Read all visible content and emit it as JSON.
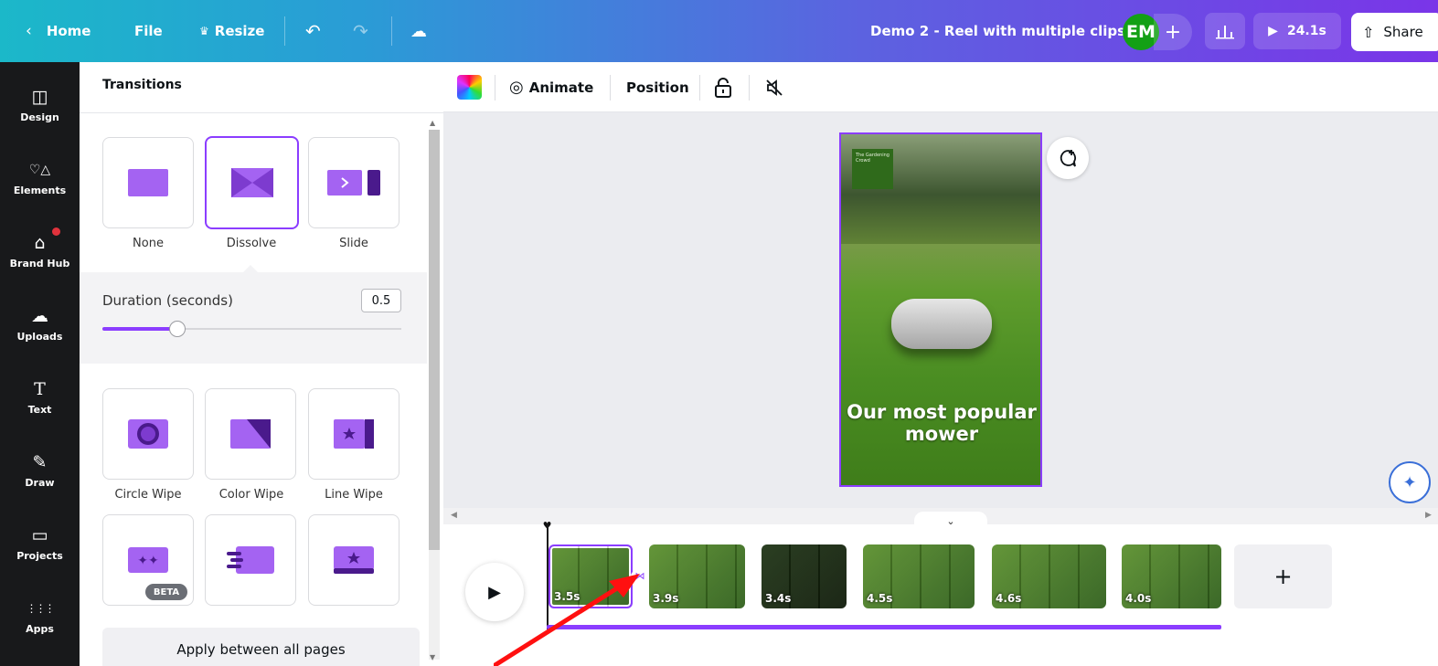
{
  "topbar": {
    "home_label": "Home",
    "file_label": "File",
    "resize_label": "Resize",
    "doc_title": "Demo 2 - Reel with multiple clips",
    "avatar_initials": "EM",
    "add_label": "+",
    "play_duration": "24.1s",
    "share_label": "Share"
  },
  "rail": {
    "items": [
      {
        "label": "Design",
        "icon": "design-icon",
        "glyph": "◫"
      },
      {
        "label": "Elements",
        "icon": "elements-icon",
        "glyph": "♡△"
      },
      {
        "label": "Brand Hub",
        "icon": "brand-hub-icon",
        "glyph": "⌂"
      },
      {
        "label": "Uploads",
        "icon": "upload-cloud-icon",
        "glyph": "☁"
      },
      {
        "label": "Text",
        "icon": "text-icon",
        "glyph": "T"
      },
      {
        "label": "Draw",
        "icon": "draw-icon",
        "glyph": "✎"
      },
      {
        "label": "Projects",
        "icon": "folder-icon",
        "glyph": "▭"
      },
      {
        "label": "Apps",
        "icon": "apps-grid-icon",
        "glyph": "⋮⋮⋮"
      }
    ]
  },
  "transitions": {
    "panel_title": "Transitions",
    "options_top": [
      {
        "label": "None"
      },
      {
        "label": "Dissolve"
      },
      {
        "label": "Slide"
      }
    ],
    "duration_label": "Duration (seconds)",
    "duration_value": "0.5",
    "duration_fraction": 0.25,
    "options_bottom": [
      {
        "label": "Circle Wipe"
      },
      {
        "label": "Color Wipe"
      },
      {
        "label": "Line Wipe"
      }
    ],
    "beta_badge": "BETA",
    "apply_label": "Apply between all pages"
  },
  "context_toolbar": {
    "animate_label": "Animate",
    "position_label": "Position"
  },
  "canvas": {
    "logo_text": "The Gardening Crowd",
    "headline": "Our most popular mower"
  },
  "timeline": {
    "clips": [
      {
        "duration": "3.5s"
      },
      {
        "duration": "3.9s"
      },
      {
        "duration": "3.4s"
      },
      {
        "duration": "4.5s"
      },
      {
        "duration": "4.6s"
      },
      {
        "duration": "4.0s"
      }
    ],
    "add_label": "+"
  },
  "colors": {
    "accent": "#8b3dff",
    "annotation_arrow": "#ff1010",
    "rail_bg": "#18191b"
  }
}
